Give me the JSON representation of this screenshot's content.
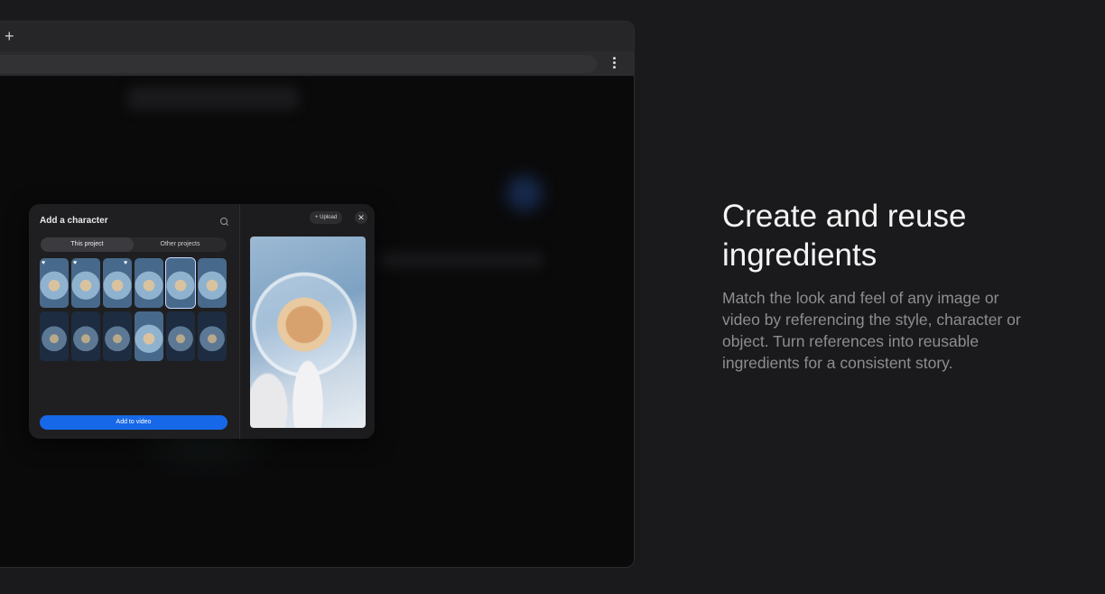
{
  "browser": {
    "new_tab_icon": "plus-icon",
    "menu_icon": "kebab-menu-icon"
  },
  "dialog": {
    "title": "Add a character",
    "search_icon": "search-icon",
    "tabs": [
      {
        "label": "This project",
        "active": true
      },
      {
        "label": "Other projects",
        "active": false
      }
    ],
    "upload_label": "+ Upload",
    "close_label": "✕",
    "add_button_label": "Add to video",
    "add_button_color": "#1668e8"
  },
  "marketing": {
    "headline": "Create and reuse ingredients",
    "description": "Match the look and feel of any image or video by referencing the style, character or object. Turn references into reusable ingredients for a consistent story."
  }
}
